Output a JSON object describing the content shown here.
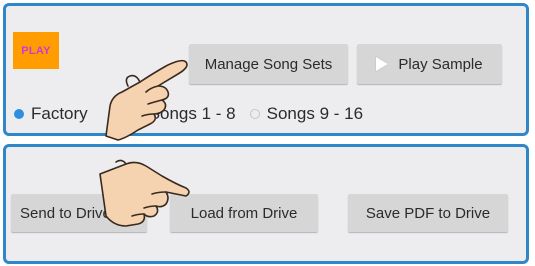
{
  "top_panel": {
    "logo_text": "PLAY",
    "manage_label": "Manage Song Sets",
    "play_sample_label": "Play Sample",
    "radio_options": [
      {
        "label": "Factory",
        "selected": true
      },
      {
        "label": "Songs 1 - 8",
        "selected": false
      },
      {
        "label": "Songs 9 - 16",
        "selected": false
      }
    ]
  },
  "bottom_panel": {
    "send_label": "Send to Drive",
    "load_label": "Load from Drive",
    "save_pdf_label": "Save PDF to Drive"
  },
  "colors": {
    "border": "#2f86c9",
    "panel_bg": "#ededf0",
    "button_bg": "#d6d6d6",
    "logo_bg": "#ff9c00",
    "logo_text": "#cc3bd2",
    "radio_selected": "#2e8fe0"
  },
  "icons": [
    "play-icon",
    "pointing-hand-icon"
  ]
}
